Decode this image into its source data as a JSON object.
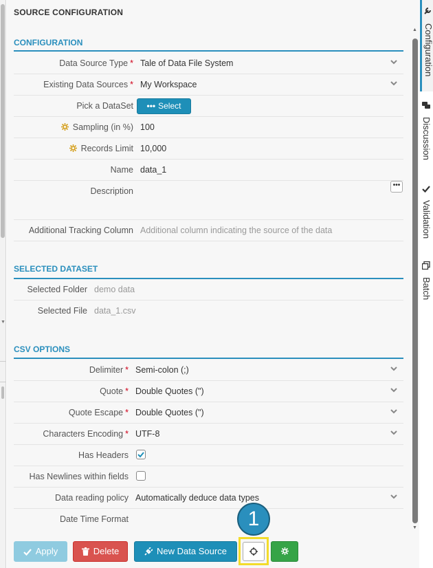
{
  "panel": {
    "title": "SOURCE CONFIGURATION"
  },
  "configuration": {
    "title": "CONFIGURATION",
    "data_source_type": {
      "label": "Data Source Type",
      "value": "Tale of Data File System"
    },
    "existing_sources": {
      "label": "Existing Data Sources",
      "value": "My Workspace"
    },
    "pick_dataset": {
      "label": "Pick a DataSet",
      "button": "Select"
    },
    "sampling": {
      "label": "Sampling (in %)",
      "value": "100"
    },
    "records_limit": {
      "label": "Records Limit",
      "value": "10,000"
    },
    "name": {
      "label": "Name",
      "value": "data_1"
    },
    "description": {
      "label": "Description",
      "button": "•••"
    },
    "tracking": {
      "label": "Additional Tracking Column",
      "placeholder": "Additional column indicating the source of the data"
    },
    "required_mark": "*"
  },
  "selected_dataset": {
    "title": "SELECTED DATASET",
    "folder": {
      "label": "Selected Folder",
      "value": "demo data"
    },
    "file": {
      "label": "Selected File",
      "value": "data_1.csv"
    }
  },
  "csv_options": {
    "title": "CSV OPTIONS",
    "delimiter": {
      "label": "Delimiter",
      "value": "Semi-colon (;)"
    },
    "quote": {
      "label": "Quote",
      "value": "Double Quotes (\")"
    },
    "quote_escape": {
      "label": "Quote Escape",
      "value": "Double Quotes (\")"
    },
    "encoding": {
      "label": "Characters Encoding",
      "value": "UTF-8"
    },
    "has_headers": {
      "label": "Has Headers",
      "checked": true
    },
    "has_newlines": {
      "label": "Has Newlines within fields",
      "checked": false
    },
    "reading_policy": {
      "label": "Data reading policy",
      "value": "Automatically deduce data types"
    },
    "datetime_format": {
      "label": "Date Time Format",
      "value": ""
    }
  },
  "actions": {
    "apply": "Apply",
    "delete": "Delete",
    "new_source": "New Data Source",
    "step_badge": "1"
  },
  "side_tabs": {
    "configuration": "Configuration",
    "discussion": "Discussion",
    "validation": "Validation",
    "batch": "Batch"
  },
  "colors": {
    "accent": "#2a8fbd",
    "required": "#d0021b",
    "gold": "#d4a01f",
    "delete": "#d9534f",
    "green": "#36a447",
    "highlight": "#f3dc2b"
  },
  "icons": {
    "chevron": "chevron-down-icon",
    "sampling": "sparkle-icon",
    "target": "crosshair-icon",
    "apply": "check-icon",
    "delete": "trash-icon",
    "new_source": "plug-icon",
    "green": "sparkle-icon"
  }
}
